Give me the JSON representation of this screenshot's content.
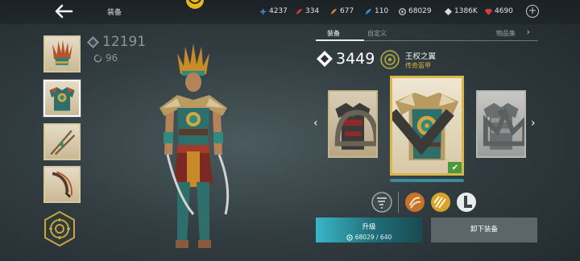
{
  "header": {
    "title": "装备",
    "resources": [
      {
        "icon": "diamond-star-icon",
        "value": "4237",
        "color": "#4f7fd6"
      },
      {
        "icon": "red-feather-icon",
        "value": "334",
        "color": "#d0422f"
      },
      {
        "icon": "orange-feather-icon",
        "value": "677",
        "color": "#e07b2a"
      },
      {
        "icon": "blue-feather-icon",
        "value": "110",
        "color": "#3e8fd8"
      },
      {
        "icon": "coin-icon",
        "value": "68029",
        "color": "#c9cdd0"
      },
      {
        "icon": "gem-icon",
        "value": "1386K",
        "color": "#d8dbdc"
      },
      {
        "icon": "ruby-icon",
        "value": "4690",
        "color": "#d43a3a"
      }
    ]
  },
  "character": {
    "gear_score": "12191",
    "level": "96"
  },
  "tabs": [
    {
      "label": "装备",
      "active": true
    },
    {
      "label": "自定义",
      "active": false
    },
    {
      "label": "物品集",
      "active": false
    }
  ],
  "item": {
    "power": "3449",
    "name": "王权之翼",
    "rarity": "传奇盔甲",
    "rarity_color": "#d8b23a"
  },
  "actions": {
    "upgrade_label": "升级",
    "upgrade_cost": "68029 / 640",
    "unequip_label": "卸下装备"
  }
}
